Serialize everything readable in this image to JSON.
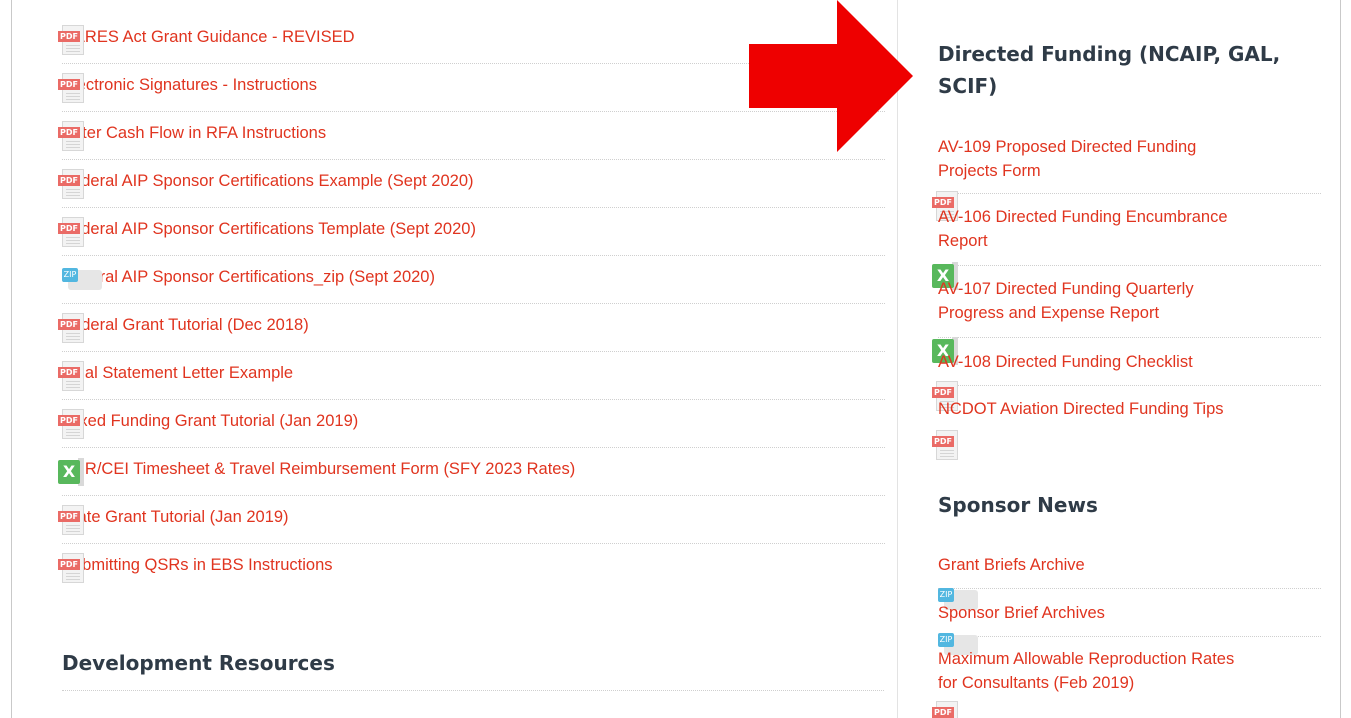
{
  "left_files": [
    {
      "label": "CARES Act Grant Guidance - REVISED",
      "icon": "pdf-icon"
    },
    {
      "label": "Electronic Signatures - Instructions",
      "icon": "pdf-icon"
    },
    {
      "label": "Enter Cash Flow in RFA Instructions",
      "icon": "pdf-icon"
    },
    {
      "label": "Federal AIP Sponsor Certifications Example (Sept 2020)",
      "icon": "pdf-icon"
    },
    {
      "label": "Federal AIP Sponsor Certifications Template (Sept 2020)",
      "icon": "pdf-icon"
    },
    {
      "label": "Federal AIP Sponsor Certifications_zip (Sept 2020)",
      "icon": "zip-icon"
    },
    {
      "label": "Federal Grant Tutorial (Dec 2018)",
      "icon": "pdf-icon"
    },
    {
      "label": "Final Statement Letter Example",
      "icon": "pdf-icon"
    },
    {
      "label": "Mixed Funding Grant Tutorial (Jan 2019)",
      "icon": "pdf-icon"
    },
    {
      "label": "RPR/CEI Timesheet & Travel Reimbursement Form (SFY 2023 Rates)",
      "icon": "excel-icon"
    },
    {
      "label": "State Grant Tutorial (Jan 2019)",
      "icon": "pdf-icon"
    },
    {
      "label": "Submitting QSRs in EBS Instructions",
      "icon": "pdf-icon"
    }
  ],
  "development_heading": "Development Resources",
  "directed_funding": {
    "heading": "Directed Funding (NCAIP, GAL, SCIF)",
    "items": [
      {
        "label": "AV-109 Proposed Directed Funding Projects Form",
        "icon": "pdf-icon"
      },
      {
        "label": "AV-106 Directed Funding Encumbrance Report",
        "icon": "excel-icon"
      },
      {
        "label": "AV-107 Directed Funding Quarterly Progress and Expense Report",
        "icon": "excel-icon"
      },
      {
        "label": "AV-108 Directed Funding Checklist",
        "icon": "pdf-icon"
      },
      {
        "label": "NCDOT Aviation Directed Funding Tips",
        "icon": "pdf-icon"
      }
    ]
  },
  "sponsor_news": {
    "heading": "Sponsor News",
    "items": [
      {
        "label": "Grant Briefs Archive",
        "icon": "zip-icon"
      },
      {
        "label": "Sponsor Brief Archives",
        "icon": "zip-icon"
      },
      {
        "label": "Maximum Allowable Reproduction Rates for Consultants (Feb 2019)",
        "icon": "pdf-icon"
      }
    ]
  },
  "icon_text": {
    "pdf": "PDF",
    "excel": "X",
    "zip": "ZIP"
  },
  "colors": {
    "link": "#e0341f",
    "heading": "#2f3b47",
    "arrow": "#ee0000",
    "pdf": "#ea6b66",
    "excel": "#58b85c",
    "zip": "#52b7e0"
  }
}
